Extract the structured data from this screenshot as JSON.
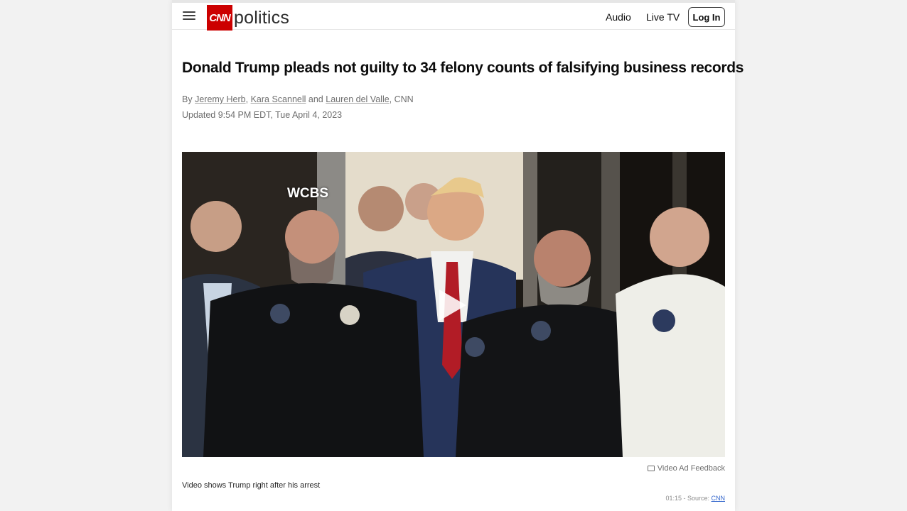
{
  "header": {
    "brand": "CNN",
    "section": "politics",
    "nav": [
      {
        "label": "Audio"
      },
      {
        "label": "Live TV"
      }
    ],
    "login_label": "Log In"
  },
  "article": {
    "headline": "Donald Trump pleads not guilty to 34 felony counts of falsifying business records",
    "byline": {
      "prefix": "By",
      "authors": [
        "Jeremy Herb",
        "Kara Scannell",
        "Lauren del Valle"
      ],
      "sep": ",",
      "and": "and",
      "outlet": ", CNN"
    },
    "timestamp": "Updated 9:54 PM EDT, Tue April 4, 2023"
  },
  "video": {
    "watermark": "WCBS",
    "feedback_label": "Video Ad Feedback",
    "caption": "Video shows Trump right after his arrest",
    "duration": "01:15",
    "source_prefix": " - Source: ",
    "source": "CNN"
  },
  "colors": {
    "brand_red": "#cc0000",
    "text": "#0c0c0c",
    "muted": "#6e6e6e"
  }
}
